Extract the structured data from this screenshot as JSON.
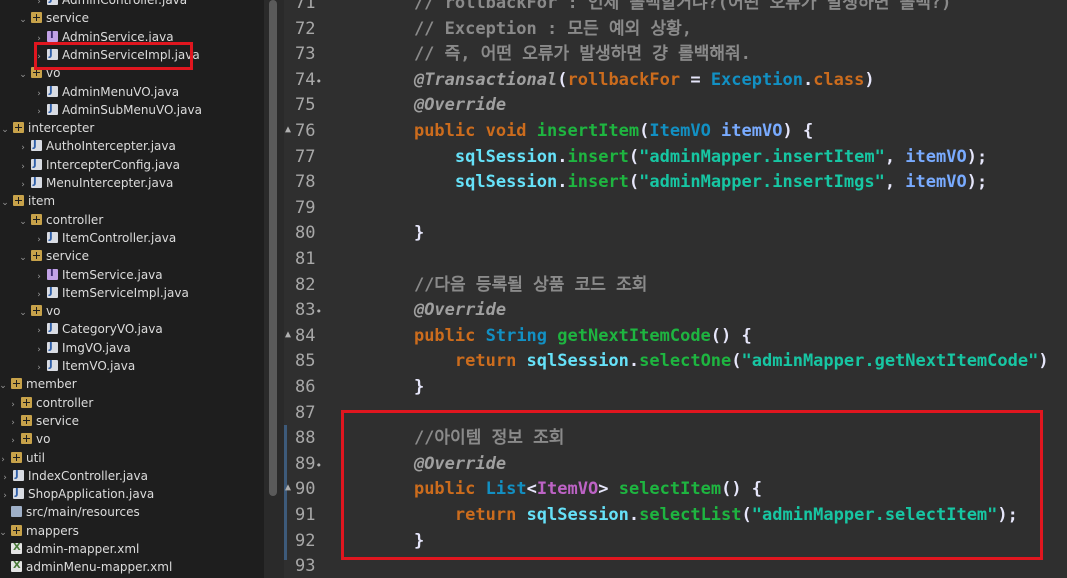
{
  "explorer": {
    "items": [
      {
        "label": "AdminController.java",
        "icon": "java-class-icon"
      },
      {
        "label": "service",
        "icon": "package-icon"
      },
      {
        "label": "AdminService.java",
        "icon": "java-interface-icon"
      },
      {
        "label": "AdminServiceImpl.java",
        "icon": "java-class-icon"
      },
      {
        "label": "vo",
        "icon": "package-icon"
      },
      {
        "label": "AdminMenuVO.java",
        "icon": "java-class-icon"
      },
      {
        "label": "AdminSubMenuVO.java",
        "icon": "java-class-icon"
      },
      {
        "label": "intercepter",
        "icon": "package-icon"
      },
      {
        "label": "AuthoIntercepter.java",
        "icon": "java-class-icon"
      },
      {
        "label": "IntercepterConfig.java",
        "icon": "java-class-icon"
      },
      {
        "label": "MenuIntercepter.java",
        "icon": "java-class-icon"
      },
      {
        "label": "item",
        "icon": "package-icon"
      },
      {
        "label": "controller",
        "icon": "package-icon"
      },
      {
        "label": "ItemController.java",
        "icon": "java-class-icon"
      },
      {
        "label": "service",
        "icon": "package-icon"
      },
      {
        "label": "ItemService.java",
        "icon": "java-interface-icon"
      },
      {
        "label": "ItemServiceImpl.java",
        "icon": "java-class-icon"
      },
      {
        "label": "vo",
        "icon": "package-icon"
      },
      {
        "label": "CategoryVO.java",
        "icon": "java-class-icon"
      },
      {
        "label": "ImgVO.java",
        "icon": "java-class-icon"
      },
      {
        "label": "ItemVO.java",
        "icon": "java-class-icon"
      },
      {
        "label": "member",
        "icon": "package-icon"
      },
      {
        "label": "controller",
        "icon": "package-icon"
      },
      {
        "label": "service",
        "icon": "package-icon"
      },
      {
        "label": "vo",
        "icon": "package-icon"
      },
      {
        "label": "util",
        "icon": "package-icon"
      },
      {
        "label": "IndexController.java",
        "icon": "java-class-icon"
      },
      {
        "label": "ShopApplication.java",
        "icon": "java-class-icon"
      },
      {
        "label": "src/main/resources",
        "icon": "folder-icon"
      },
      {
        "label": "mappers",
        "icon": "package-icon"
      },
      {
        "label": "admin-mapper.xml",
        "icon": "xml-file-icon"
      },
      {
        "label": "adminMenu-mapper.xml",
        "icon": "xml-file-icon"
      }
    ]
  },
  "editor": {
    "line_numbers": [
      "71",
      "72",
      "73",
      "74",
      "75",
      "76",
      "77",
      "78",
      "79",
      "80",
      "81",
      "82",
      "83",
      "84",
      "85",
      "86",
      "87",
      "88",
      "89",
      "90",
      "91",
      "92",
      "93"
    ],
    "lines": [
      [
        {
          "t": "    // rollbackFor : 언제 롤백할거냐?(어떤 오류가 발생하면 롤백?)",
          "c": "comment"
        }
      ],
      [
        {
          "t": "    // Exception : 모든 예외 상황,",
          "c": "comment"
        }
      ],
      [
        {
          "t": "    // 즉, 어떤 오류가 발생하면 걍 롤백해줘.",
          "c": "comment"
        }
      ],
      [
        {
          "t": "    ",
          "c": "plain"
        },
        {
          "t": "@Transactional",
          "c": "ann"
        },
        {
          "t": "(",
          "c": "plain"
        },
        {
          "t": "rollbackFor",
          "c": "kw"
        },
        {
          "t": " = ",
          "c": "plain"
        },
        {
          "t": "Exception",
          "c": "type"
        },
        {
          "t": ".",
          "c": "plain"
        },
        {
          "t": "class",
          "c": "kw"
        },
        {
          "t": ")",
          "c": "plain"
        }
      ],
      [
        {
          "t": "    ",
          "c": "plain"
        },
        {
          "t": "@Override",
          "c": "ann"
        }
      ],
      [
        {
          "t": "    ",
          "c": "plain"
        },
        {
          "t": "public void ",
          "c": "kw"
        },
        {
          "t": "insertItem",
          "c": "method"
        },
        {
          "t": "(",
          "c": "plain"
        },
        {
          "t": "ItemVO ",
          "c": "type"
        },
        {
          "t": "itemVO",
          "c": "param"
        },
        {
          "t": ") {",
          "c": "plain"
        }
      ],
      [
        {
          "t": "        ",
          "c": "plain"
        },
        {
          "t": "sqlSession",
          "c": "field"
        },
        {
          "t": ".",
          "c": "plain"
        },
        {
          "t": "insert",
          "c": "method"
        },
        {
          "t": "(",
          "c": "plain"
        },
        {
          "t": "\"adminMapper.insertItem\"",
          "c": "str"
        },
        {
          "t": ", ",
          "c": "plain"
        },
        {
          "t": "itemVO",
          "c": "param"
        },
        {
          "t": ");",
          "c": "plain"
        }
      ],
      [
        {
          "t": "        ",
          "c": "plain"
        },
        {
          "t": "sqlSession",
          "c": "field"
        },
        {
          "t": ".",
          "c": "plain"
        },
        {
          "t": "insert",
          "c": "method"
        },
        {
          "t": "(",
          "c": "plain"
        },
        {
          "t": "\"adminMapper.insertImgs\"",
          "c": "str"
        },
        {
          "t": ", ",
          "c": "plain"
        },
        {
          "t": "itemVO",
          "c": "param"
        },
        {
          "t": ");",
          "c": "plain"
        }
      ],
      [
        {
          "t": "",
          "c": "plain"
        }
      ],
      [
        {
          "t": "    }",
          "c": "plain"
        }
      ],
      [
        {
          "t": "",
          "c": "plain"
        }
      ],
      [
        {
          "t": "    //다음 등록될 상품 코드 조회",
          "c": "comment"
        }
      ],
      [
        {
          "t": "    ",
          "c": "plain"
        },
        {
          "t": "@Override",
          "c": "ann"
        }
      ],
      [
        {
          "t": "    ",
          "c": "plain"
        },
        {
          "t": "public ",
          "c": "kw"
        },
        {
          "t": "String ",
          "c": "type"
        },
        {
          "t": "getNextItemCode",
          "c": "method"
        },
        {
          "t": "() {",
          "c": "plain"
        }
      ],
      [
        {
          "t": "        ",
          "c": "plain"
        },
        {
          "t": "return ",
          "c": "kw"
        },
        {
          "t": "sqlSession",
          "c": "field"
        },
        {
          "t": ".",
          "c": "plain"
        },
        {
          "t": "selectOne",
          "c": "method"
        },
        {
          "t": "(",
          "c": "plain"
        },
        {
          "t": "\"adminMapper.getNextItemCode\"",
          "c": "str"
        },
        {
          "t": ")",
          "c": "plain"
        }
      ],
      [
        {
          "t": "    }",
          "c": "plain"
        }
      ],
      [
        {
          "t": "",
          "c": "plain"
        }
      ],
      [
        {
          "t": "    //아이템 정보 조회",
          "c": "comment"
        }
      ],
      [
        {
          "t": "    ",
          "c": "plain"
        },
        {
          "t": "@Override",
          "c": "ann"
        }
      ],
      [
        {
          "t": "    ",
          "c": "plain"
        },
        {
          "t": "public ",
          "c": "kw"
        },
        {
          "t": "List",
          "c": "type"
        },
        {
          "t": "<",
          "c": "plain"
        },
        {
          "t": "ItemVO",
          "c": "gen"
        },
        {
          "t": "> ",
          "c": "plain"
        },
        {
          "t": "selectItem",
          "c": "method"
        },
        {
          "t": "() {",
          "c": "plain"
        }
      ],
      [
        {
          "t": "        ",
          "c": "plain"
        },
        {
          "t": "return ",
          "c": "kw"
        },
        {
          "t": "sqlSession",
          "c": "field"
        },
        {
          "t": ".",
          "c": "plain"
        },
        {
          "t": "selectList",
          "c": "method"
        },
        {
          "t": "(",
          "c": "plain"
        },
        {
          "t": "\"adminMapper.selectItem\"",
          "c": "str"
        },
        {
          "t": ");",
          "c": "plain"
        }
      ],
      [
        {
          "t": "    }",
          "c": "plain"
        }
      ],
      [
        {
          "t": "",
          "c": "plain"
        }
      ]
    ]
  },
  "colors": {
    "highlight_box": "#e0161f",
    "editor_background": "#2f2f2f",
    "explorer_background": "#1e1e1e"
  }
}
